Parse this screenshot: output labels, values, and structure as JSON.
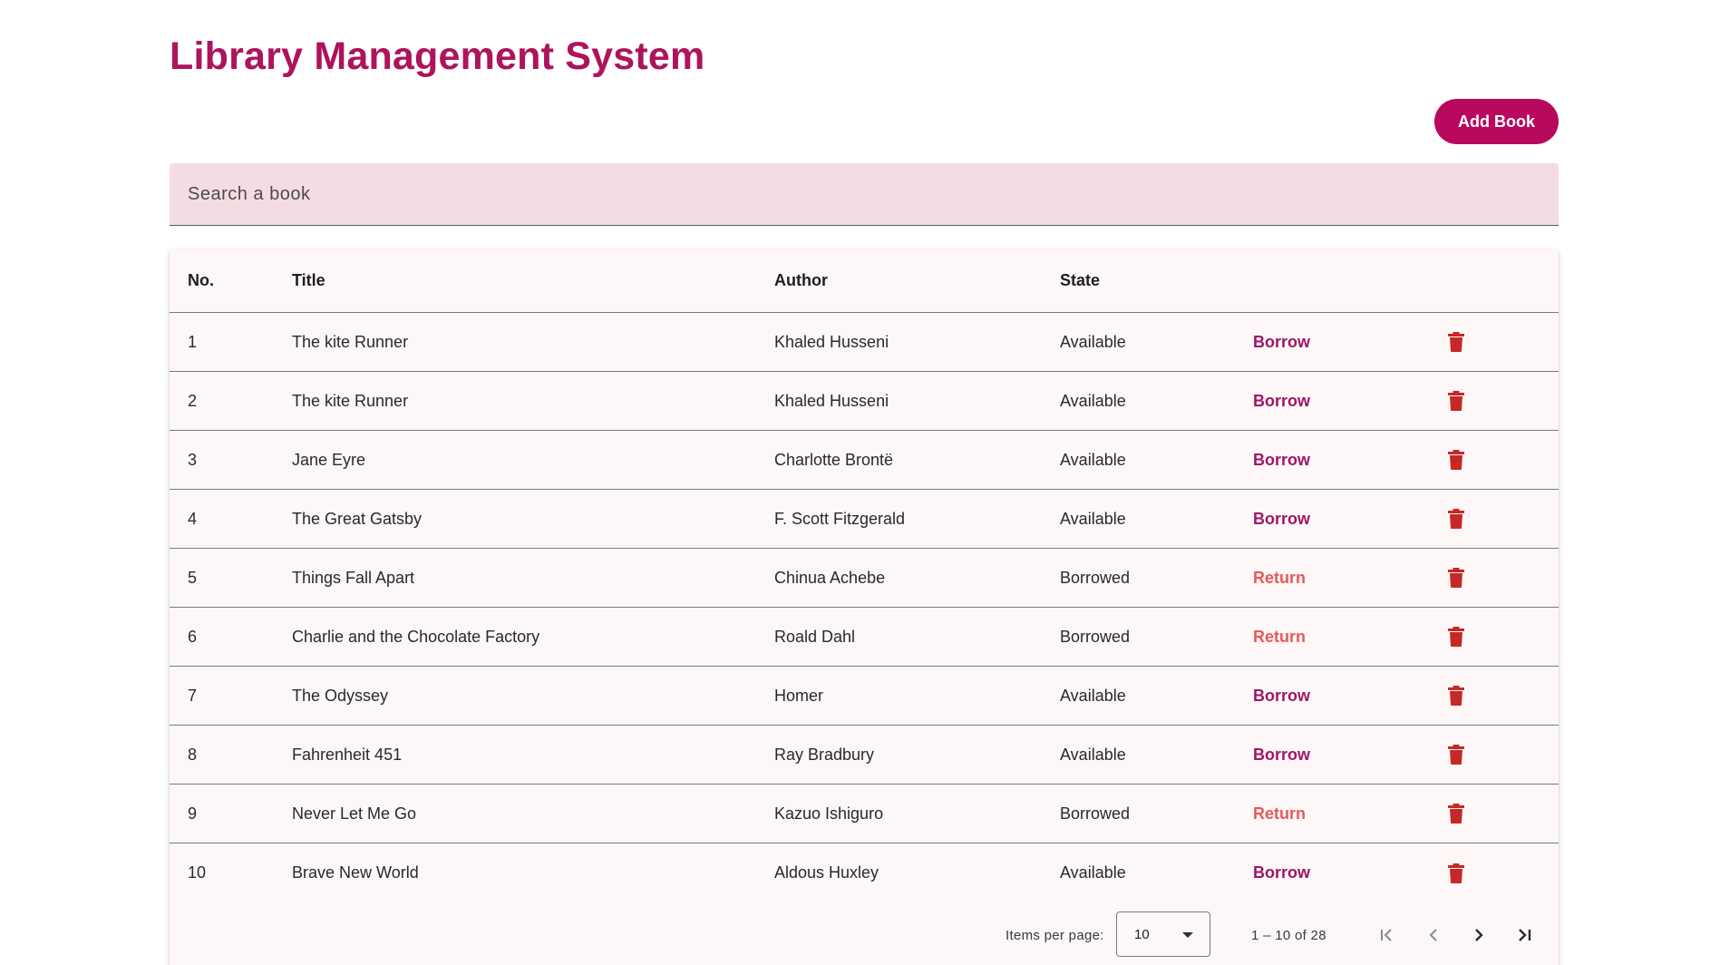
{
  "header": {
    "title": "Library Management System",
    "add_button_label": "Add Book"
  },
  "search": {
    "placeholder": "Search a book",
    "value": ""
  },
  "table": {
    "columns": {
      "no": "No.",
      "title": "Title",
      "author": "Author",
      "state": "State"
    },
    "rows": [
      {
        "no": "1",
        "title": "The kite Runner",
        "author": "Khaled Husseni",
        "state": "Available",
        "action": "Borrow"
      },
      {
        "no": "2",
        "title": "The kite Runner",
        "author": "Khaled Husseni",
        "state": "Available",
        "action": "Borrow"
      },
      {
        "no": "3",
        "title": "Jane Eyre",
        "author": "Charlotte Brontë",
        "state": "Available",
        "action": "Borrow"
      },
      {
        "no": "4",
        "title": "The Great Gatsby",
        "author": "F. Scott Fitzgerald",
        "state": "Available",
        "action": "Borrow"
      },
      {
        "no": "5",
        "title": "Things Fall Apart",
        "author": "Chinua Achebe",
        "state": "Borrowed",
        "action": "Return"
      },
      {
        "no": "6",
        "title": "Charlie and the Chocolate Factory",
        "author": "Roald Dahl",
        "state": "Borrowed",
        "action": "Return"
      },
      {
        "no": "7",
        "title": "The Odyssey",
        "author": "Homer",
        "state": "Available",
        "action": "Borrow"
      },
      {
        "no": "8",
        "title": "Fahrenheit 451",
        "author": "Ray Bradbury",
        "state": "Available",
        "action": "Borrow"
      },
      {
        "no": "9",
        "title": "Never Let Me Go",
        "author": "Kazuo Ishiguro",
        "state": "Borrowed",
        "action": "Return"
      },
      {
        "no": "10",
        "title": "Brave New World",
        "author": "Aldous Huxley",
        "state": "Available",
        "action": "Borrow"
      }
    ],
    "delete_icon": "trash-icon"
  },
  "paginator": {
    "items_per_page_label": "Items per page:",
    "items_per_page_value": "10",
    "range_label": "1 – 10 of 28",
    "icons": {
      "first": "first-page-icon",
      "prev": "chevron-left-icon",
      "next": "chevron-right-icon",
      "last": "last-page-icon"
    }
  },
  "colors": {
    "brand": "#ad145c",
    "button": "#b8095f",
    "borrow": "#9c1767",
    "return": "#e65a5a",
    "delete": "#c62828",
    "search_bg": "#f4dde2",
    "table_bg": "#fdf7f7"
  }
}
